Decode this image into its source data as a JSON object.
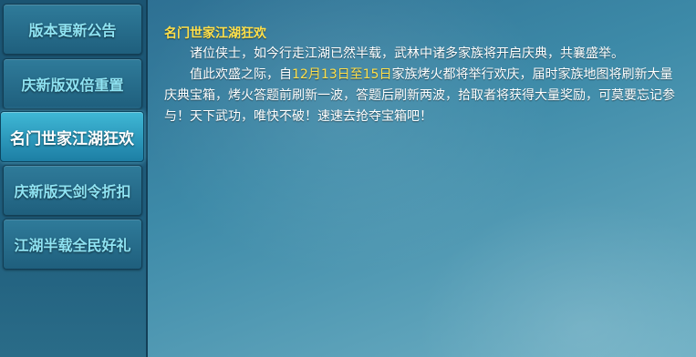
{
  "sidebar": {
    "tabs": [
      {
        "label": "版本更新公告"
      },
      {
        "label": "庆新版双倍重置"
      },
      {
        "label": "名门世家江湖狂欢"
      },
      {
        "label": "庆新版天剑令折扣"
      },
      {
        "label": "江湖半载全民好礼"
      }
    ]
  },
  "content": {
    "title": "名门世家江湖狂欢",
    "para1": "诸位侠士，如今行走江湖已然半载，武林中诸多家族将开启庆典，共襄盛举。",
    "para2_prefix": "值此欢盛之际，自",
    "para2_date": "12月13日至15日",
    "para2_suffix": "家族烤火都将举行欢庆，届时家族地图将刷新大量庆典宝箱，烤火答题前刷新一波，答题后刷新两波，拾取者将获得大量奖励，可莫要忘记参与！天下武功，唯快不破！速速去抢夺宝箱吧！"
  },
  "colors": {
    "highlight": "#ffe04a",
    "text": "#ffffff",
    "tab_text": "#8fe3f2"
  }
}
